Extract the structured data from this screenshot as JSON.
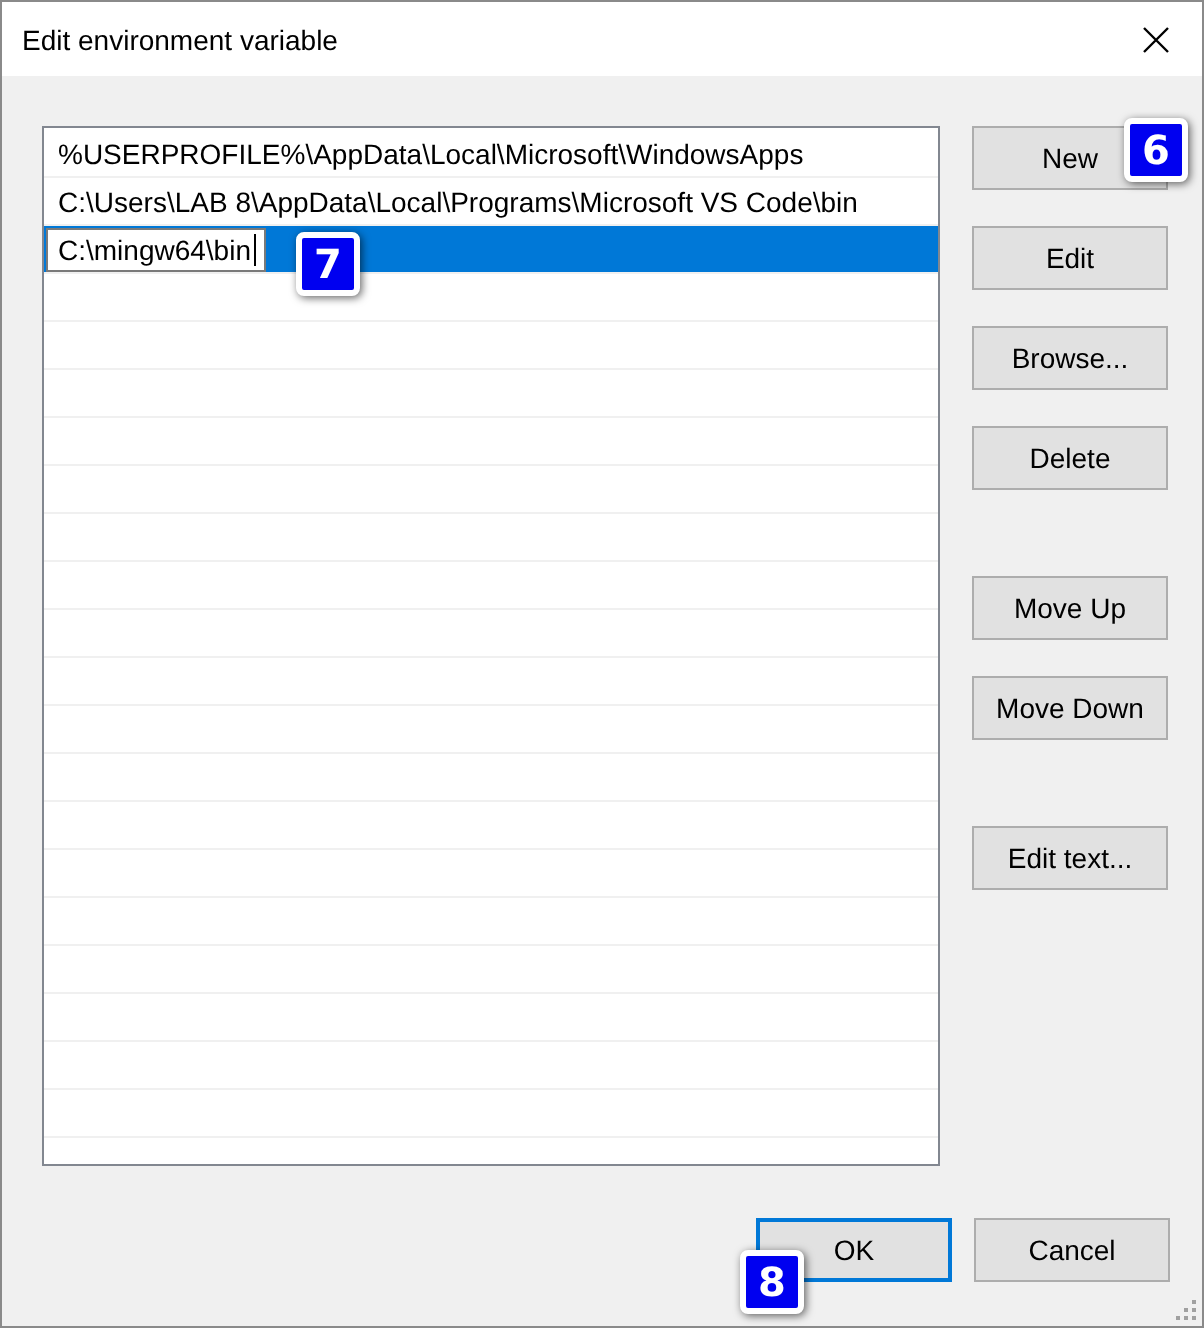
{
  "window": {
    "title": "Edit environment variable"
  },
  "entries": [
    {
      "text": "%USERPROFILE%\\AppData\\Local\\Microsoft\\WindowsApps",
      "selected": false,
      "editing": false
    },
    {
      "text": "C:\\Users\\LAB 8\\AppData\\Local\\Programs\\Microsoft VS Code\\bin",
      "selected": false,
      "editing": false
    },
    {
      "text": "C:\\mingw64\\bin",
      "selected": true,
      "editing": true,
      "callout": "7"
    }
  ],
  "button_groups": [
    [
      {
        "label": "New",
        "callout": "6"
      },
      {
        "label": "Edit"
      },
      {
        "label": "Browse..."
      },
      {
        "label": "Delete"
      }
    ],
    [
      {
        "label": "Move Up"
      },
      {
        "label": "Move Down"
      }
    ],
    [
      {
        "label": "Edit text..."
      }
    ]
  ],
  "footer_buttons": [
    {
      "label": "OK",
      "default": true,
      "callout": "8"
    },
    {
      "label": "Cancel",
      "default": false
    }
  ]
}
